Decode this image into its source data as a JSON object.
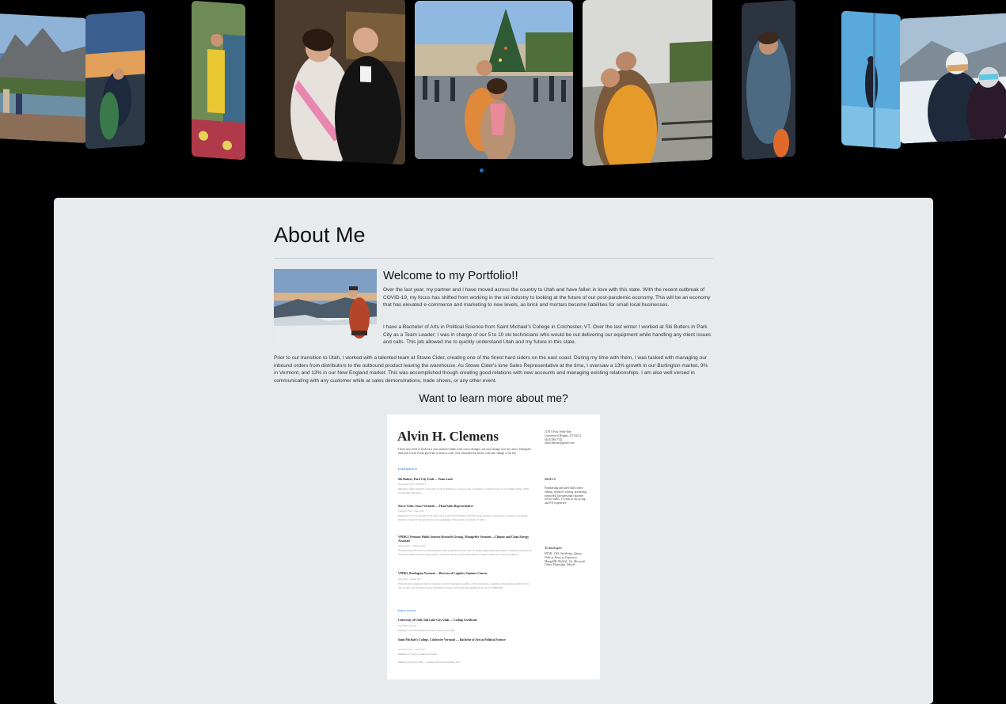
{
  "carousel": {
    "photos": [
      {
        "name": "mountain-lake-photo"
      },
      {
        "name": "sunset-couple-photo"
      },
      {
        "name": "market-photo"
      },
      {
        "name": "formal-couple-photo"
      },
      {
        "name": "christmas-tree-square-photo"
      },
      {
        "name": "river-overlook-photo"
      },
      {
        "name": "campfire-photo"
      },
      {
        "name": "snowy-night-photo"
      },
      {
        "name": "ski-couple-photo"
      }
    ],
    "active_indicator_color": "#1a6fd1"
  },
  "about": {
    "title": "About Me",
    "welcome_heading": "Welcome to my Portfolio!!",
    "paragraph1": "Over the last year, my partner and I have moved across the country to Utah and have fallen in love with this state. With the recent outbreak of COVID-19, my focus has shifted from working in the ski industry to looking at the future of our post-pandemic economy. This will be an economy that has elevated e-commerce and marketing to new levels, as brick and mortars become liabilities for small local businesses.",
    "paragraph2": "I have a Bachelor of Arts in Political Science from Saint Michael's College in Colchester, VT. Over the last winter I worked at Ski Butlers in Park City as a Team Leader; I was in charge of our 5 to 10 ski technicians who would be out delivering our equipment while handling any client issues and calls. This job allowed me to quickly understand Utah and my future in this state.",
    "paragraph3": "Prior to our transition to Utah, I worked with a talented team at Stowe Cider, creating one of the finest hard ciders on the east coast. During my time with them, I was tasked with managing our inbound orders from distributors to the outbound product leaving the warehouse. As Stowe Cider's lone Sales Representative at the time, I oversaw a 13% growth in our Burlington market, 9% in Vermont, and 13% in our New England market. This was accomplished though creating good relations with new accounts and managing existing relationships. I am also well versed in communicating with any customer while at sales demonstrations, trade shows, or any other event.",
    "learn_more": "Want to learn more about me?"
  },
  "resume": {
    "name": "Alvin H. Clemens",
    "intro": "I have now lived in Utah for a year and have made some career changes, one such change is in my career. Taking the time that Covid-19 has given me to learn to code. This adventure has been a welcome change to my life",
    "experience_heading": "EXPERIENCE",
    "jobs": [
      {
        "title": "Ski Butlers, Park City Utah — Team Lead",
        "date": "November 2019 - PRESENT",
        "desc": "Managed client relations and teams of ski technicians on day-to-day operations. Created routes for upcoming shifts, while conducting deliveries."
      },
      {
        "title": "Stowe Cider, Stowe Vermont — Head Sales Representative",
        "date": "February 2018 - June 2019",
        "desc": "Managed a 13.5% growth in all cider sales in the New England and New York markets, opened new accounts in existing markets, helped in the production and packaging of thousands of gallons of cider."
      },
      {
        "title": "VPIRG (Vermont Public Interest Research Group), Montpelier Vermont —Climate and Clean Energy Associate",
        "date": "August 2017 - January 2018",
        "desc": "Worked with advocates on informing the state population about uses of Volkswagen settlement funds, conducted research on Vermont enhanced state energy plans, educated citizens on the Smart Plan to reduce Vermont's carbon footprint."
      },
      {
        "title": "VPIRG, Burlington Vermont —Director of Logistics Summer Canvas",
        "date": "May 2016 - August 2017",
        "desc": "Planned and organized trips for summer canvas; managed an office of 20 canvassers, organized all logistical needs for the day-to-day; self-fundraised over $20,000 and help reach team fundraising goals of over $800,000."
      }
    ],
    "education_heading": "EDUCATION",
    "education": [
      {
        "title": "University of Utah, Salt Lake City Utah — Coding Certificate",
        "date": "July 2020 - Present",
        "desc": "During Covid-19 I seeked to learn a new career path"
      },
      {
        "title": "Saint Michael's College, Colchester Vermont — Bachelor of Arts in Political Science",
        "date": "AUGUST 2013 - MAY 2017",
        "desc": "Member of Varsity Alpine Ski Team"
      },
      {
        "title": "",
        "date": "",
        "desc": "Member of Nordi SMC — skiing and snowboarding club"
      }
    ],
    "contact": "1276 S Palo Verde Way\nCottonwood Heights, UT 84121\n(414) 586-7532\nalvinclemens@gmail.com",
    "skills_heading": "SKILLS",
    "skills": "Fundraising and sales skills,video editing, research, writing, presenting, teamwork, Interpersonal/customer service skills, 15 years of ski racing and P/E experience",
    "tech_heading": "Technologies",
    "tech": "HTML, CSS, JavaScript, jQuery, Node.js, React.js, Express.js, MongoDB, MySQL, Git, Microsoft Office, Photoshop, iMovie"
  }
}
